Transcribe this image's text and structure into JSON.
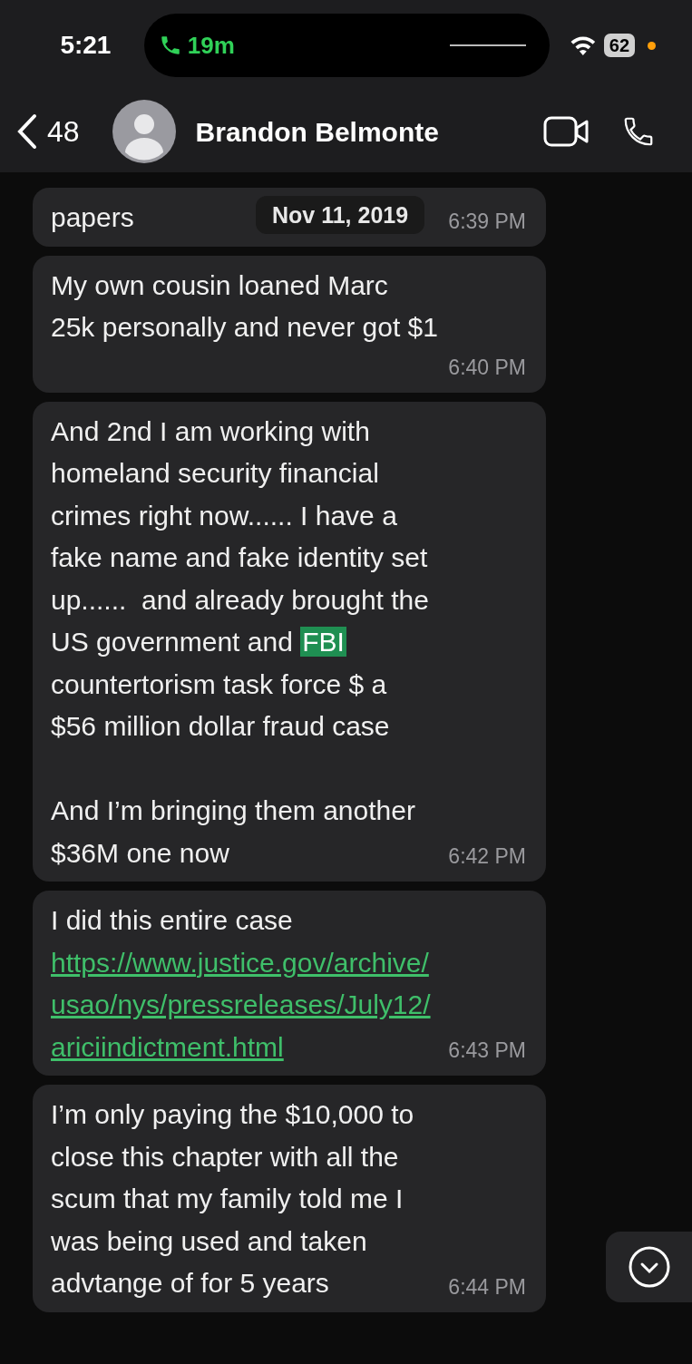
{
  "status_bar": {
    "time": "5:21",
    "call_duration": "19m",
    "battery": "62"
  },
  "header": {
    "back_count": "48",
    "contact_name": "Brandon Belmonte"
  },
  "date_divider": "Nov 11, 2019",
  "messages": [
    {
      "parts": [
        {
          "kind": "text",
          "text": "papers"
        }
      ],
      "time": "6:39 PM"
    },
    {
      "parts": [
        {
          "kind": "text",
          "text": "My own cousin loaned Marc\n25k personally and never got $1"
        }
      ],
      "time": "6:40 PM"
    },
    {
      "parts": [
        {
          "kind": "text",
          "text": "And 2nd I am working with\nhomeland security financial\ncrimes right now...... I have a\nfake name and fake identity set\nup......  and already brought the\nUS government and "
        },
        {
          "kind": "highlight",
          "text": "FBI"
        },
        {
          "kind": "text",
          "text": "\ncountertorism task force $ a\n$56 million dollar fraud case\n\nAnd I’m bringing them another\n$36M one now"
        }
      ],
      "time": "6:42 PM"
    },
    {
      "parts": [
        {
          "kind": "text",
          "text": "I did this entire case\n"
        },
        {
          "kind": "link",
          "text": "https://www.justice.gov/archive/\nusao/nys/pressreleases/July12/\nariciindictment.html"
        }
      ],
      "time": "6:43 PM"
    },
    {
      "parts": [
        {
          "kind": "text",
          "text": "I’m only paying the $10,000 to\nclose this chapter with all the\nscum that my family told me I\nwas being used and taken\nadvtange of for 5 years"
        }
      ],
      "time": "6:44 PM"
    }
  ]
}
